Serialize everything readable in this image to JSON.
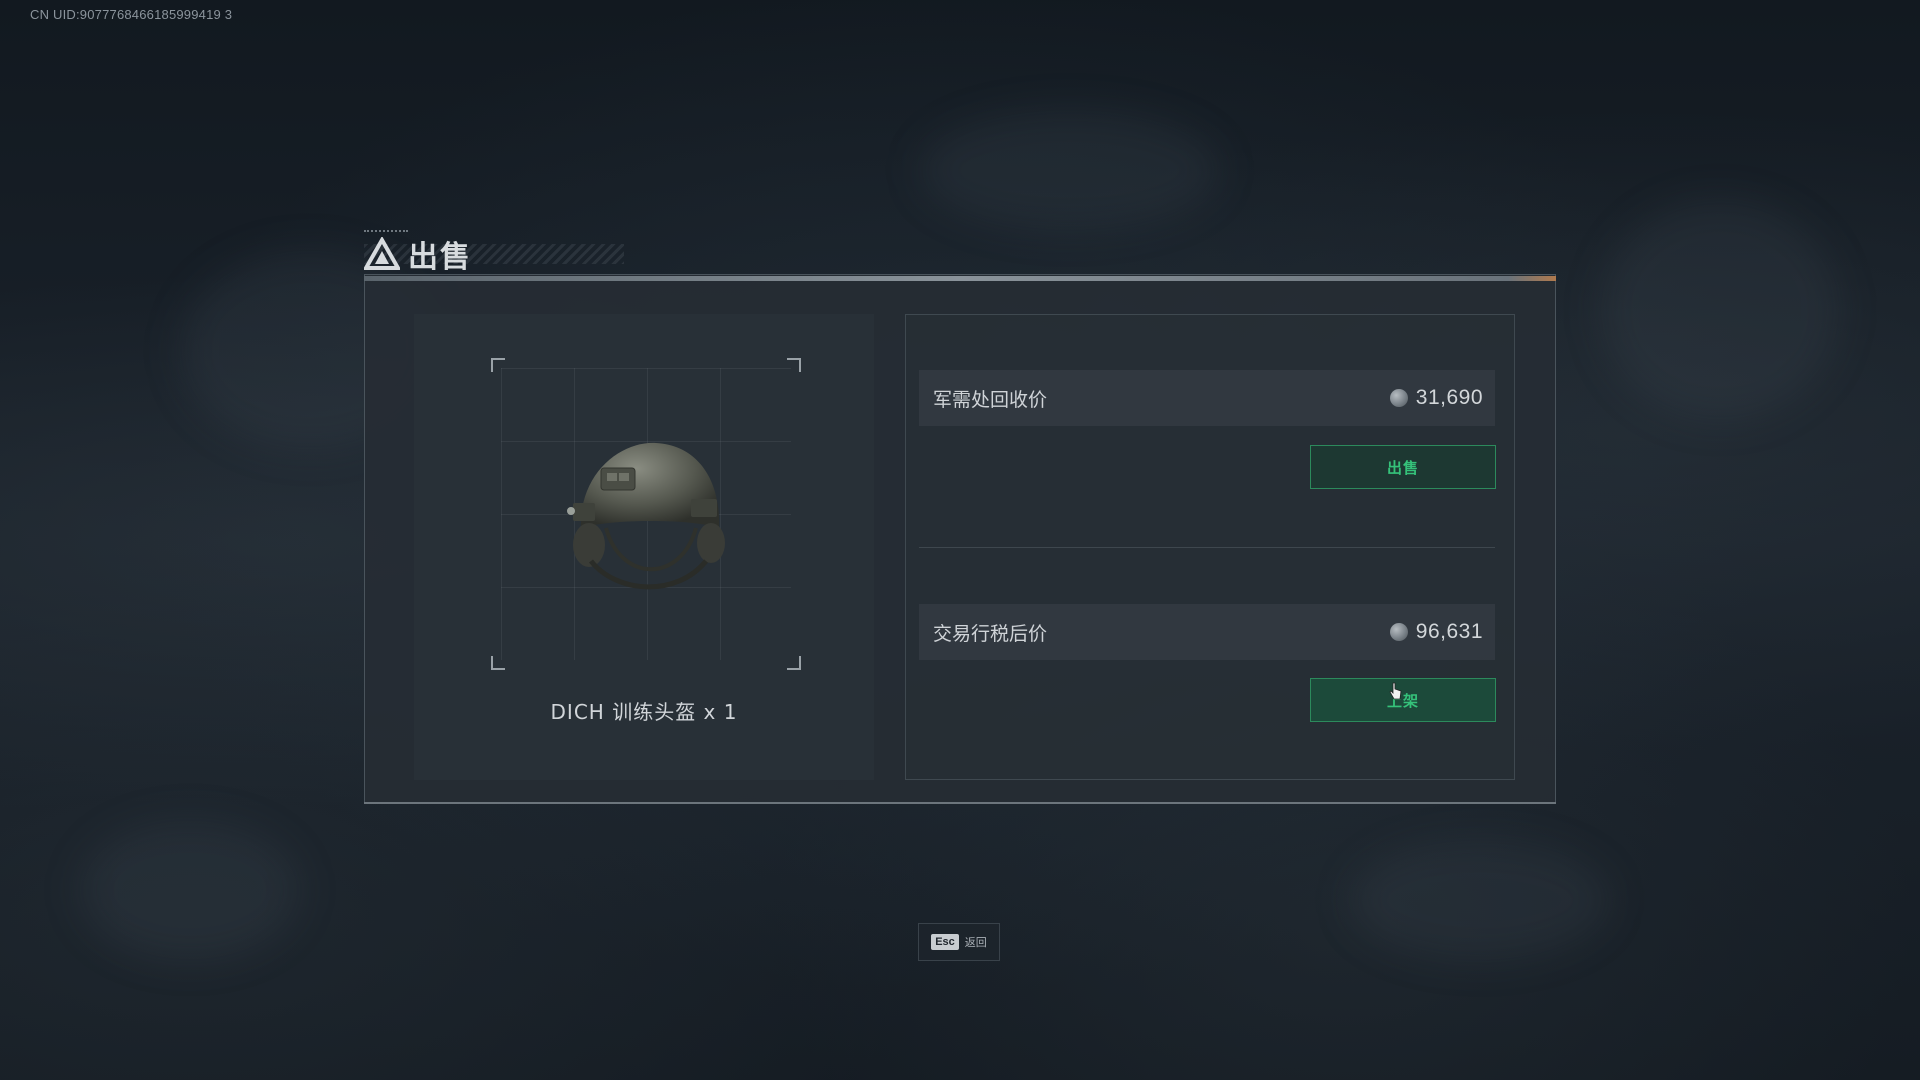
{
  "uid_text": "CN UID:9077768466185999419 3",
  "dialog": {
    "title": "出售"
  },
  "item": {
    "name": "DICH 训练头盔 x 1",
    "icon": "helmet-icon"
  },
  "prices": [
    {
      "label": "军需处回收价",
      "value": "31,690",
      "button_label": "出售"
    },
    {
      "label": "交易行税后价",
      "value": "96,631",
      "button_label": "上架"
    }
  ],
  "footer": {
    "key": "Esc",
    "label": "返回"
  },
  "colors": {
    "accent_green": "#35c27a",
    "background": "#161d25"
  }
}
